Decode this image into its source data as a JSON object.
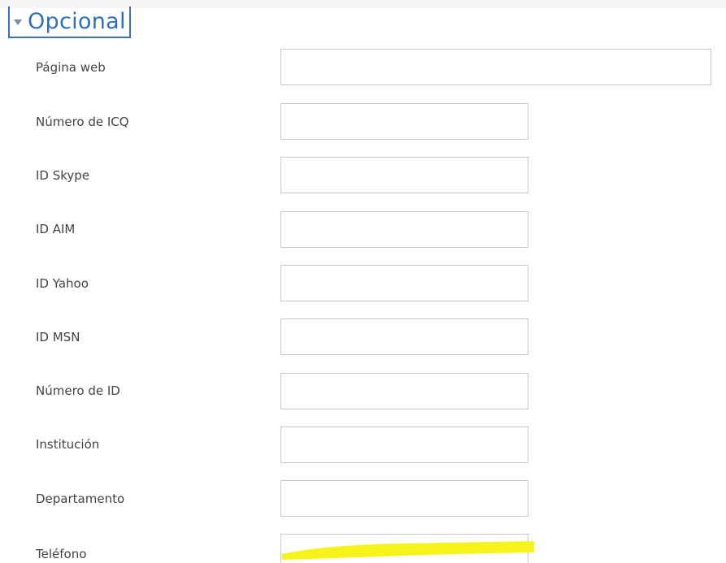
{
  "section": {
    "title": "Opcional",
    "icon": "chevron-down-icon"
  },
  "fields": [
    {
      "label": "Página web",
      "value": "",
      "placeholder": ""
    },
    {
      "label": "Número de ICQ",
      "value": "",
      "placeholder": ""
    },
    {
      "label": "ID Skype",
      "value": "",
      "placeholder": ""
    },
    {
      "label": "ID AIM",
      "value": "",
      "placeholder": ""
    },
    {
      "label": "ID Yahoo",
      "value": "",
      "placeholder": ""
    },
    {
      "label": "ID MSN",
      "value": "",
      "placeholder": ""
    },
    {
      "label": "Número de ID",
      "value": "",
      "placeholder": ""
    },
    {
      "label": "Institución",
      "value": "",
      "placeholder": ""
    },
    {
      "label": "Departamento",
      "value": "",
      "placeholder": ""
    },
    {
      "label": "Teléfono",
      "value": "",
      "placeholder": ""
    }
  ],
  "colors": {
    "accent": "#2f6fc0",
    "highlight": "#f7f21a"
  }
}
